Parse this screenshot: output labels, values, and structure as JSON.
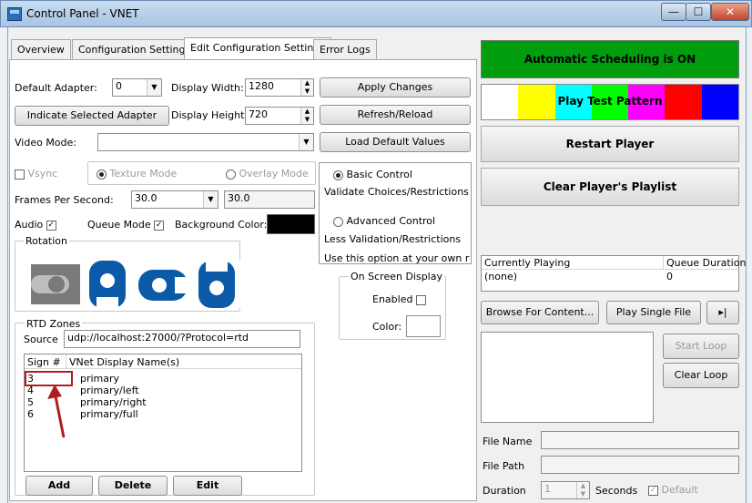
{
  "window": {
    "title": "Control Panel - VNET",
    "min_glyph": "—",
    "max_glyph": "☐",
    "close_glyph": "✕"
  },
  "tabs": [
    {
      "label": "Overview"
    },
    {
      "label": "Configuration Settings"
    },
    {
      "label": "Edit Configuration Settings"
    },
    {
      "label": "Error Logs"
    }
  ],
  "settings": {
    "default_adapter_label": "Default Adapter:",
    "default_adapter_value": "0",
    "display_width_label": "Display Width:",
    "display_width_value": "1280",
    "display_height_label": "Display Height:",
    "display_height_value": "720",
    "indicate_adapter_button": "Indicate Selected Adapter",
    "video_mode_label": "Video Mode:",
    "video_mode_value": "",
    "vsync_label": "Vsync",
    "texture_mode_label": "Texture Mode",
    "overlay_mode_label": "Overlay Mode",
    "fps_label": "Frames Per Second:",
    "fps_value": "30.0",
    "fps_field_value": "30.0",
    "audio_label": "Audio",
    "queue_mode_label": "Queue Mode",
    "background_color_label": "Background Color:",
    "background_color": "#000000"
  },
  "actions": {
    "apply_changes": "Apply Changes",
    "refresh_reload": "Refresh/Reload",
    "load_defaults": "Load Default Values"
  },
  "control_mode": {
    "basic_label": "Basic Control",
    "basic_desc": "Validate Choices/Restrictions",
    "advanced_label": "Advanced Control",
    "advanced_desc": "Less Validation/Restrictions",
    "warning": "Use this option at your own risl"
  },
  "osd": {
    "title": "On Screen Display",
    "enabled_label": "Enabled",
    "color_label": "Color:",
    "color_value": "#ffffff"
  },
  "rotation": {
    "title": "Rotation",
    "tile_color": "#0a5aa8"
  },
  "rtd": {
    "title": "RTD Zones",
    "source_label": "Source",
    "source_value": "udp://localhost:27000/?Protocol=rtd",
    "col_sign": "Sign #",
    "col_name": "VNet Display Name(s)",
    "rows": [
      {
        "sign": "3",
        "name": "primary"
      },
      {
        "sign": "4",
        "name": "primary/left"
      },
      {
        "sign": "5",
        "name": "primary/right"
      },
      {
        "sign": "6",
        "name": "primary/full"
      }
    ],
    "add": "Add",
    "delete": "Delete",
    "edit": "Edit"
  },
  "right": {
    "auto_sched": "Automatic Scheduling is ON",
    "auto_sched_color": "#009e0f",
    "test_pattern": "Play Test Pattern",
    "pattern_colors": [
      "#ffffff",
      "#ffff00",
      "#00ffff",
      "#00ff00",
      "#ff00ff",
      "#ff0000",
      "#0000ff"
    ],
    "restart": "Restart Player",
    "clear_playlist": "Clear Player's Playlist",
    "col_playing": "Currently Playing",
    "col_queue": "Queue Duration",
    "playing_value": "(none)",
    "queue_value": "0",
    "browse": "Browse For Content...",
    "play_single": "Play Single File",
    "next_glyph": "▸|",
    "start_loop": "Start Loop",
    "clear_loop": "Clear Loop",
    "file_name_label": "File Name",
    "file_path_label": "File Path",
    "duration_label": "Duration",
    "duration_value": "1",
    "seconds_label": "Seconds",
    "default_label": "Default"
  }
}
